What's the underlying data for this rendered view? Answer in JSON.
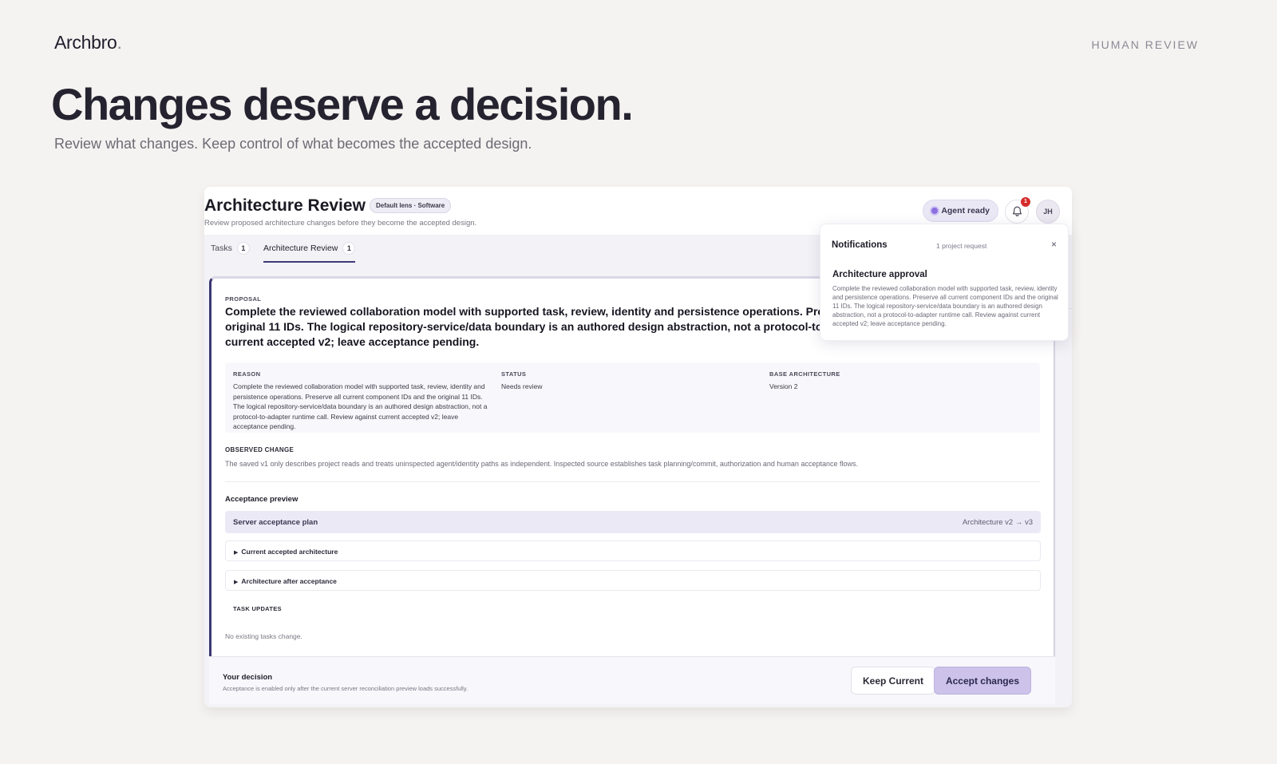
{
  "page": {
    "brand": "Archbro",
    "brand_dot": ".",
    "section_tag": "HUMAN REVIEW",
    "headline": "Changes deserve a decision.",
    "subhead": "Review what changes. Keep control of what becomes the accepted design."
  },
  "app": {
    "title": "Architecture Review",
    "lens_badge": "Default lens · Software",
    "subtitle": "Review proposed architecture changes before they become the accepted design.",
    "agent_status": "Agent ready",
    "notification_count": "1",
    "avatar_initials": "JH",
    "tabs": [
      {
        "label": "Tasks",
        "count": "1"
      },
      {
        "label": "Architecture Review",
        "count": "1"
      }
    ]
  },
  "proposal": {
    "label": "PROPOSAL",
    "text": "Complete the reviewed collaboration model with supported task, review, identity and persistence operations. Preserve all current component IDs and the original 11 IDs. The logical repository-service/data boundary is an authored design abstraction, not a protocol-to-adapter runtime call. Review against current accepted v2; leave acceptance pending.",
    "reason_label": "REASON",
    "reason_text": "Complete the reviewed collaboration model with supported task, review, identity and persistence operations. Preserve all current component IDs and the original 11 IDs. The logical repository-service/data boundary is an authored design abstraction, not a protocol-to-adapter runtime call. Review against current accepted v2; leave acceptance pending.",
    "status_label": "STATUS",
    "status_value": "Needs review",
    "base_label": "BASE ARCHITECTURE",
    "base_value": "Version 2",
    "observed_label": "OBSERVED CHANGE",
    "observed_text": "The saved v1 only describes project reads and treats uninspected agent/identity paths as independent. Inspected source establishes task planning/commit, authorization and human acceptance flows."
  },
  "acceptance": {
    "title": "Acceptance preview",
    "plan_label": "Server acceptance plan",
    "plan_version": "Architecture v2 → v3",
    "current_label": "Current accepted architecture",
    "after_label": "Architecture after acceptance",
    "task_updates_label": "TASK UPDATES",
    "no_tasks": "No existing tasks change."
  },
  "decision": {
    "title": "Your decision",
    "hint": "Acceptance is enabled only after the current server reconciliation preview loads successfully.",
    "keep_label": "Keep Current",
    "accept_label": "Accept changes"
  },
  "notifications": {
    "title": "Notifications",
    "count_text": "1 project request",
    "close_glyph": "×",
    "item_title": "Architecture approval",
    "item_body": "Complete the reviewed collaboration model with supported task, review, identity and persistence operations. Preserve all current component IDs and the original 11 IDs. The logical repository-service/data boundary is an authored design abstraction, not a protocol-to-adapter runtime call. Review against current accepted v2; leave acceptance pending."
  },
  "colors": {
    "background": "#f5f3f1",
    "accent": "#3b3872",
    "accept_button": "#cdc3ea",
    "badge_red": "#d62b2b"
  },
  "icons": [
    "bell-icon",
    "close-icon",
    "caret-right-icon",
    "status-dot-icon"
  ]
}
